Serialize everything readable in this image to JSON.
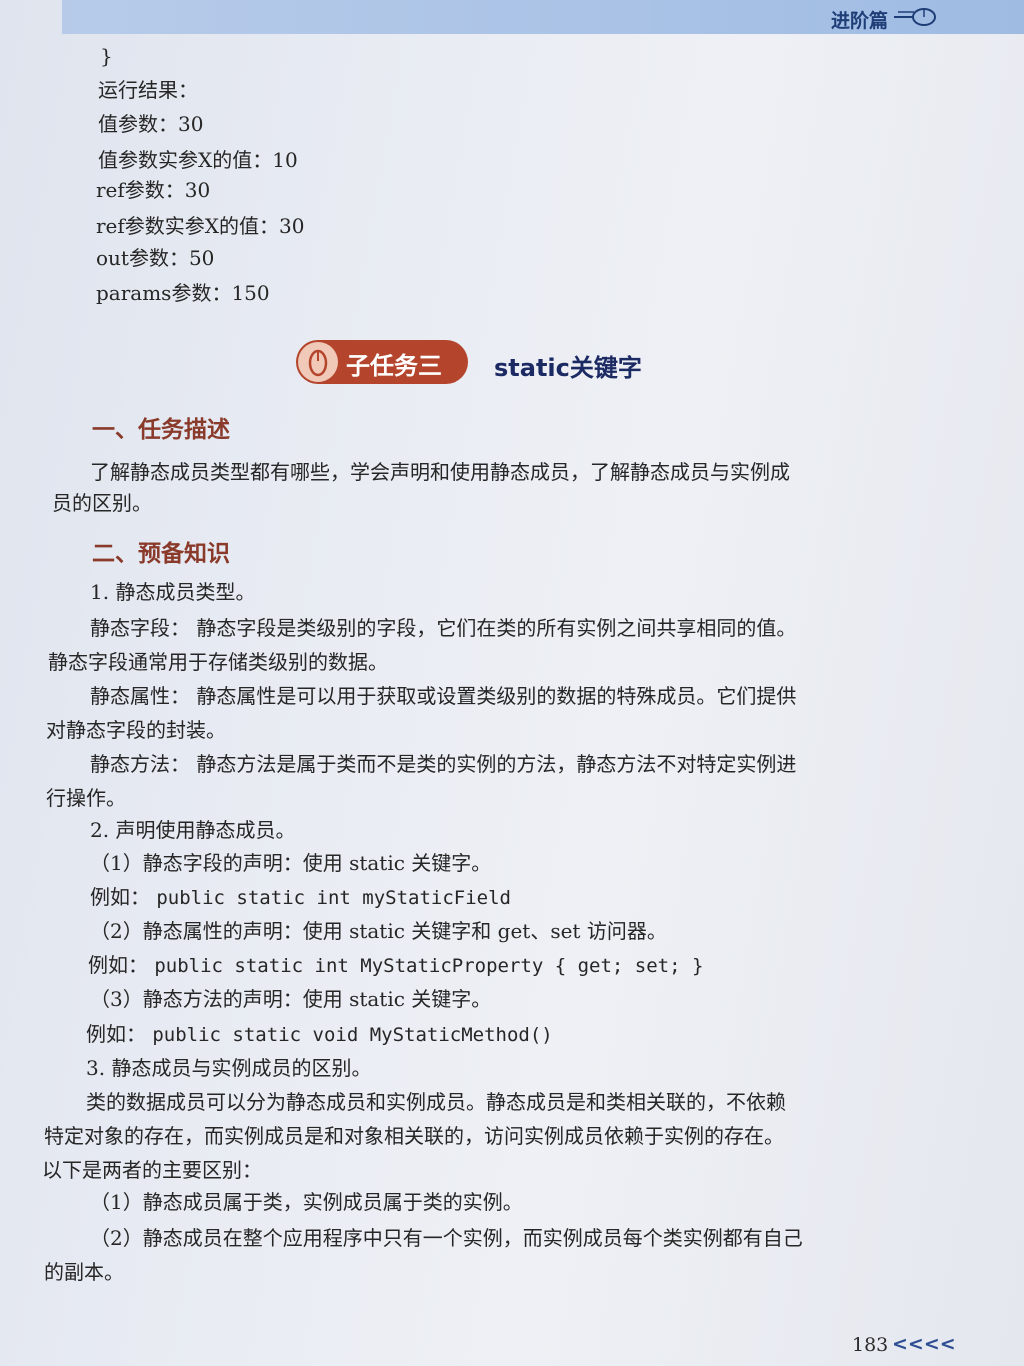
{
  "header": {
    "section": "进阶篇",
    "icon": "mouse-icon"
  },
  "output_block": {
    "closing_brace": "}",
    "heading": "运行结果：",
    "lines": [
      "值参数：30",
      "值参数实参X的值：10",
      "ref参数：30",
      "ref参数实参X的值：30",
      "out参数：50",
      "params参数：150"
    ]
  },
  "subtask": {
    "badge": "子任务三",
    "title": "static关键字",
    "icon": "mouse-icon"
  },
  "sections": {
    "description_title": "一、任务描述",
    "description_body": [
      "了解静态成员类型都有哪些，学会声明和使用静态成员，了解静态成员与实例成",
      "员的区别。"
    ],
    "knowledge_title": "二、预备知识"
  },
  "body": {
    "p1_title": "1. 静态成员类型。",
    "static_field": [
      "静态字段：  静态字段是类级别的字段，它们在类的所有实例之间共享相同的值。",
      "静态字段通常用于存储类级别的数据。"
    ],
    "static_property": [
      "静态属性：  静态属性是可以用于获取或设置类级别的数据的特殊成员。它们提供",
      "对静态字段的封装。"
    ],
    "static_method": [
      "静态方法：  静态方法是属于类而不是类的实例的方法，静态方法不对特定实例进",
      "行操作。"
    ],
    "p2_title": "2. 声明使用静态成员。",
    "decl_field": "（1）静态字段的声明：使用 static 关键字。",
    "example_label": "例如：",
    "code1": "public static int myStaticField",
    "decl_property": "（2）静态属性的声明：使用 static 关键字和 get、set 访问器。",
    "code2": "public static int MyStaticProperty { get;  set;  }",
    "decl_method": "（3）静态方法的声明：使用 static 关键字。",
    "code3": "public static void MyStaticMethod()",
    "p3_title": "3. 静态成员与实例成员的区别。",
    "diff_intro": [
      "类的数据成员可以分为静态成员和实例成员。静态成员是和类相关联的，不依赖",
      "特定对象的存在，而实例成员是和对象相关联的，访问实例成员依赖于实例的存在。",
      "以下是两者的主要区别："
    ],
    "diff1": "（1）静态成员属于类，实例成员属于类的实例。",
    "diff2": [
      "（2）静态成员在整个应用程序中只有一个实例，而实例成员每个类实例都有自己",
      "的副本。"
    ]
  },
  "footer": {
    "page_number": "183",
    "arrows": "<<<<"
  },
  "colors": {
    "heading_red": "#8a3a2a",
    "badge_red": "#b4452c",
    "title_navy": "#1c2a63",
    "band_blue": "#a9c2e6"
  }
}
